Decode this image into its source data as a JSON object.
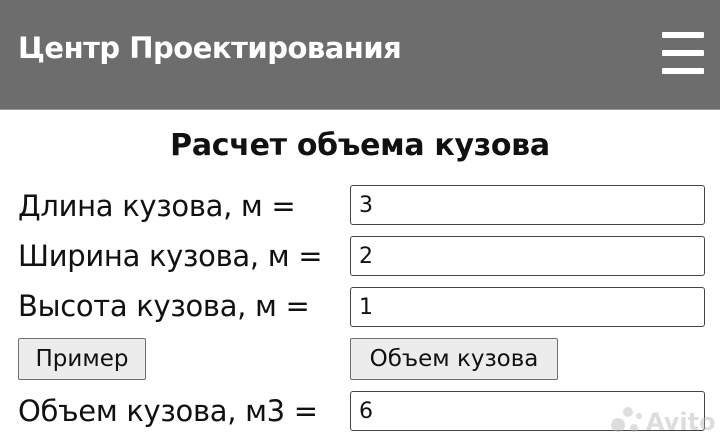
{
  "header": {
    "title": "Центр Проектирования",
    "menu_icon": "hamburger-menu-icon"
  },
  "form": {
    "title": "Расчет объема кузова",
    "length": {
      "label": "Длина кузова, м =",
      "value": "3"
    },
    "width": {
      "label": "Ширина кузова, м =",
      "value": "2"
    },
    "height": {
      "label": "Высота кузова, м =",
      "value": "1"
    },
    "example_button": "Пример",
    "calculate_button": "Объем кузова",
    "result": {
      "label": "Объем кузова, м3 =",
      "value": "6"
    }
  },
  "watermark": {
    "text": "Avito",
    "icon": "avito-logo-icon"
  },
  "colors": {
    "header_background": "#6d6d6d",
    "header_text": "#ffffff",
    "button_background": "#ececec",
    "field_border": "#444444"
  }
}
